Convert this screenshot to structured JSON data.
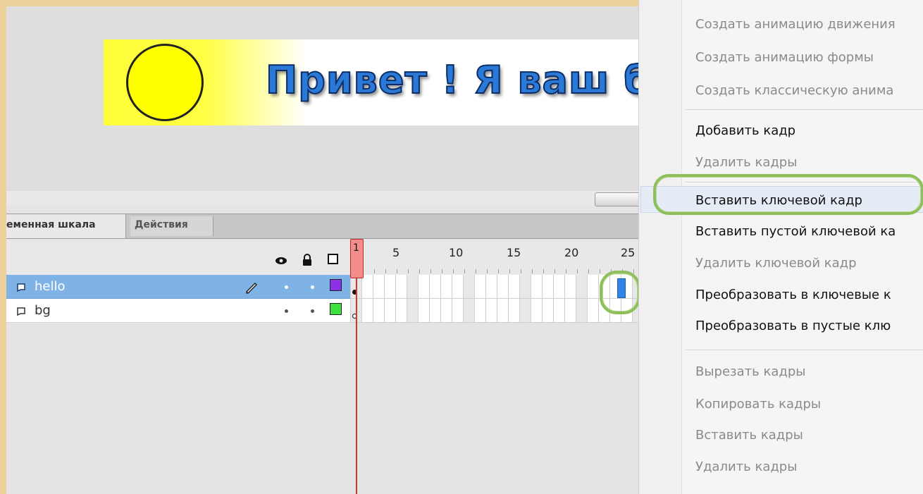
{
  "stage": {
    "banner_text": "Привет ! Я ваш бан"
  },
  "timeline": {
    "tabs": [
      "еменная шкала",
      "Действия"
    ],
    "ruler": [
      "1",
      "5",
      "10",
      "15",
      "20",
      "25"
    ],
    "layers": [
      {
        "name": "hello",
        "color": "#8a32e6",
        "selected": true
      },
      {
        "name": "bg",
        "color": "#3ee03e",
        "selected": false
      }
    ]
  },
  "context_menu": {
    "items": [
      {
        "label": "Создать анимацию движения",
        "enabled": false
      },
      {
        "label": "Создать анимацию формы",
        "enabled": false
      },
      {
        "label": "Создать классическую анима",
        "enabled": false
      },
      {
        "label": "Добавить кадр",
        "enabled": true
      },
      {
        "label": "Удалить кадры",
        "enabled": false
      },
      {
        "label": "Вставить ключевой кадр",
        "enabled": true,
        "highlighted": true
      },
      {
        "label": "Вставить пустой ключевой ка",
        "enabled": true
      },
      {
        "label": "Удалить ключевой кадр",
        "enabled": false
      },
      {
        "label": "Преобразовать в ключевые к",
        "enabled": true
      },
      {
        "label": "Преобразовать в пустые клю",
        "enabled": true
      },
      {
        "label": "Вырезать кадры",
        "enabled": false
      },
      {
        "label": "Копировать кадры",
        "enabled": false
      },
      {
        "label": "Вставить кадры",
        "enabled": false
      },
      {
        "label": "Удалить кадры",
        "enabled": false
      }
    ]
  },
  "colors": {
    "highlight_ring": "#8fbf5c",
    "selected_layer": "#7fb2e5",
    "playhead": "#d43434",
    "selected_frame": "#2f84e6"
  }
}
